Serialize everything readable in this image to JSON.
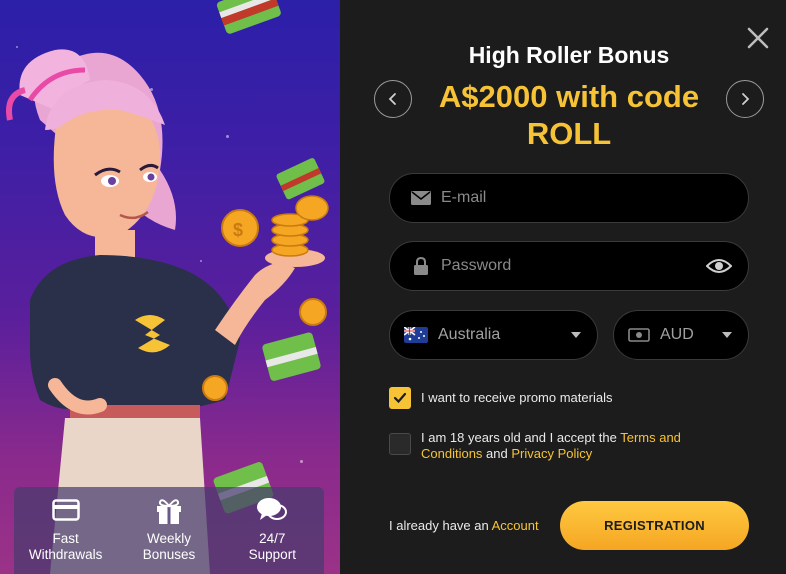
{
  "promo": {
    "features": [
      {
        "icon": "credit-card-icon",
        "label": "Fast\nWithdrawals"
      },
      {
        "icon": "gift-icon",
        "label": "Weekly\nBonuses"
      },
      {
        "icon": "chat-bubbles-icon",
        "label": "24/7\nSupport"
      }
    ]
  },
  "modal": {
    "title": "High Roller Bonus",
    "offer": "A$2000 with code ROLL",
    "email_placeholder": "E-mail",
    "password_placeholder": "Password",
    "country": "Australia",
    "currency": "AUD",
    "promo_checkbox": {
      "checked": true,
      "label": "I want to receive promo materials"
    },
    "age_checkbox": {
      "checked": false,
      "text_before": "I am 18 years old and I accept the ",
      "terms_link": "Terms and Conditions",
      "text_middle": " and ",
      "privacy_link": "Privacy Policy"
    },
    "have_account_text": "I already have an ",
    "account_link": "Account",
    "register_button": "REGISTRATION"
  },
  "colors": {
    "accent": "#f7c336",
    "panel_bg": "#1c1c1c",
    "field_bg": "#000000"
  }
}
